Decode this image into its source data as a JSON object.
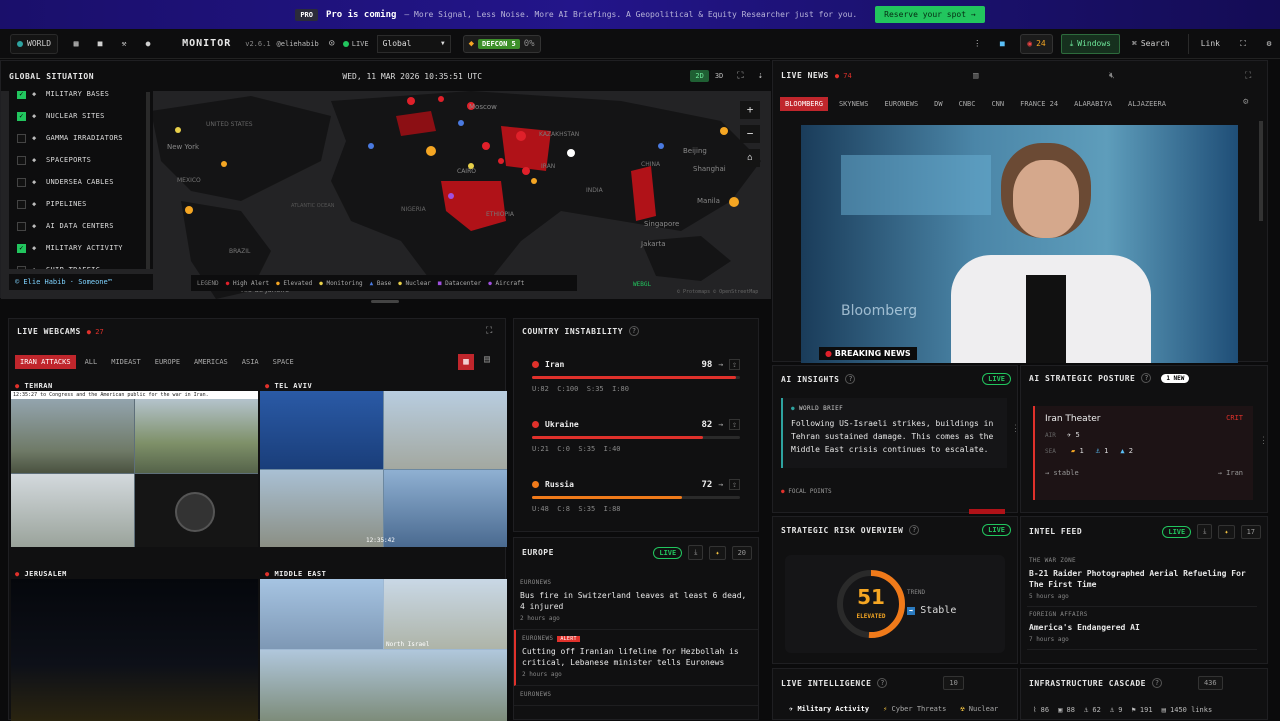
{
  "promo": {
    "badge": "PRO",
    "headline": "Pro is coming",
    "text": "— More Signal, Less Noise. More AI Briefings. A Geopolitical & Equity Researcher just for you.",
    "cta": "Reserve your spot →"
  },
  "topbar": {
    "world": "WORLD",
    "brand": "MONITOR",
    "version": "v2.6.1",
    "user": "@eliehabib",
    "live": "LIVE",
    "region": "Global",
    "defcon": "DEFCON 5",
    "defcon_pct": "0%",
    "alerts": "24",
    "windows": "Windows",
    "search": "Search",
    "link": "Link"
  },
  "global": {
    "title": "GLOBAL SITUATION",
    "datetime": "WED, 11 MAR 2026 10:35:51 UTC",
    "mode_2d": "2D",
    "mode_3d": "3D",
    "layers": [
      {
        "label": "MILITARY BASES",
        "on": true
      },
      {
        "label": "NUCLEAR SITES",
        "on": true
      },
      {
        "label": "GAMMA IRRADIATORS",
        "on": false
      },
      {
        "label": "SPACEPORTS",
        "on": false
      },
      {
        "label": "UNDERSEA CABLES",
        "on": false
      },
      {
        "label": "PIPELINES",
        "on": false
      },
      {
        "label": "AI DATA CENTERS",
        "on": false
      },
      {
        "label": "MILITARY ACTIVITY",
        "on": true
      },
      {
        "label": "SHIP TRAFFIC",
        "on": false
      }
    ],
    "credit": "© Elie Habib · Someone™",
    "legend": {
      "title": "LEGEND",
      "items": [
        "High Alert",
        "Elevated",
        "Monitoring",
        "Base",
        "Nuclear",
        "Datacenter",
        "Aircraft"
      ]
    },
    "webgl": "WEBGL",
    "attribution": "© Protomaps © OpenStreetMap",
    "places": [
      "Moscow",
      "KAZAKHSTAN",
      "New York",
      "MEXICO",
      "BRAZIL",
      "Rio de Janeiro",
      "UNITED STATES",
      "CAIRO",
      "IRAN",
      "INDIA",
      "CHINA",
      "ETHIOPIA",
      "Beijing",
      "Shanghai",
      "Manila",
      "Singapore",
      "Jakarta",
      "NIGERIA",
      "ATLANTIC OCEAN"
    ]
  },
  "webcams": {
    "title": "LIVE WEBCAMS",
    "count": "27",
    "tabs": [
      "IRAN ATTACKS",
      "ALL",
      "MIDEAST",
      "EUROPE",
      "AMERICAS",
      "ASIA",
      "SPACE"
    ],
    "feeds": [
      "TEHRAN",
      "TEL AVIV",
      "JERUSALEM",
      "MIDDLE EAST"
    ],
    "tehran_ticker": "to Congress and the American public for the war in Iran.",
    "tehran_clock": "12:35:27",
    "telaviv_clock": "12:35:42",
    "label_north_israel": "North Israel"
  },
  "instability": {
    "title": "COUNTRY INSTABILITY",
    "rows": [
      {
        "name": "Iran",
        "score": "98",
        "arrow": "→",
        "sub": "U:82  C:100  S:35  I:80",
        "pct": 98,
        "color": "#e0312b"
      },
      {
        "name": "Ukraine",
        "score": "82",
        "arrow": "→",
        "sub": "U:21  C:0  S:35  I:40",
        "pct": 82,
        "color": "#e0312b"
      },
      {
        "name": "Russia",
        "score": "72",
        "arrow": "→",
        "sub": "U:48  C:8  S:35  I:88",
        "pct": 72,
        "color": "#f07a1a"
      }
    ]
  },
  "europe": {
    "title": "EUROPE",
    "live": "LIVE",
    "count": "20",
    "items": [
      {
        "src": "EURONEWS",
        "alert": "",
        "title": "Bus fire in Switzerland leaves at least 6 dead, 4 injured",
        "time": "2 hours ago"
      },
      {
        "src": "EURONEWS",
        "alert": "ALERT",
        "title": "Cutting off Iranian lifeline for Hezbollah is critical, Lebanese minister tells Euronews",
        "time": "2 hours ago"
      },
      {
        "src": "EURONEWS",
        "alert": "",
        "title": "",
        "time": ""
      }
    ]
  },
  "livenews": {
    "title": "LIVE NEWS",
    "count": "74",
    "channels": [
      "BLOOMBERG",
      "SKYNEWS",
      "EURONEWS",
      "DW",
      "CNBC",
      "CNN",
      "FRANCE 24",
      "ALARABIYA",
      "ALJAZEERA"
    ],
    "breaking": "BREAKING NEWS",
    "watermark": "Bloomberg"
  },
  "insights": {
    "title": "AI INSIGHTS",
    "live": "LIVE",
    "brief_label": "WORLD BRIEF",
    "brief": "Following US-Israeli strikes, buildings in Tehran sustained damage. This comes as the Middle East crisis continues to escalate.",
    "focal": "FOCAL POINTS"
  },
  "posture": {
    "title": "AI STRATEGIC POSTURE",
    "new_badge": "1 NEW",
    "theater": "Iran Theater",
    "level": "CRIT",
    "air_label": "AIR",
    "air_count": "5",
    "sea_label": "SEA",
    "sea": [
      "1",
      "1",
      "2"
    ],
    "trend": "stable",
    "focus": "Iran"
  },
  "risk": {
    "title": "STRATEGIC RISK OVERVIEW",
    "live": "LIVE",
    "score": "51",
    "score_value": 51,
    "level": "ELEVATED",
    "trend_label": "TREND",
    "trend": "Stable"
  },
  "intel": {
    "title": "INTEL FEED",
    "live": "LIVE",
    "count": "17",
    "items": [
      {
        "src": "THE WAR ZONE",
        "title": "B-21 Raider Photographed Aerial Refueling For The First Time",
        "time": "5 hours ago"
      },
      {
        "src": "FOREIGN AFFAIRS",
        "title": "America's Endangered AI",
        "time": "7 hours ago"
      }
    ]
  },
  "liveintel": {
    "title": "LIVE INTELLIGENCE",
    "count": "10",
    "tabs": [
      "Military Activity",
      "Cyber Threats",
      "Nuclear"
    ]
  },
  "cascade": {
    "title": "INFRASTRUCTURE CASCADE",
    "count": "436",
    "stats": [
      "86",
      "88",
      "62",
      "9",
      "191",
      "1450 links"
    ]
  }
}
